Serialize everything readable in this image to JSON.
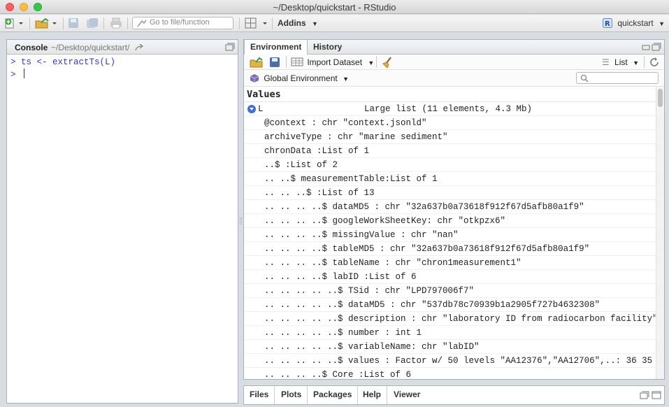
{
  "window": {
    "title": "~/Desktop/quickstart - RStudio"
  },
  "toolbar": {
    "goto_placeholder": "Go to file/function",
    "addins_label": "Addins",
    "project_label": "quickstart"
  },
  "console": {
    "title": "Console",
    "path": "~/Desktop/quickstart/",
    "lines": [
      {
        "prompt": ">",
        "code": "ts <- extractTs(L)"
      },
      {
        "prompt": ">",
        "code": ""
      }
    ]
  },
  "environment": {
    "tabs": [
      "Environment",
      "History"
    ],
    "import_dataset_label": "Import Dataset",
    "view_mode_label": "List",
    "scope_label": "Global Environment",
    "section_title": "Values",
    "object": {
      "name": "L",
      "description": "Large list (11 elements, 4.3 Mb)"
    },
    "rows": [
      "@context : chr \"context.jsonld\"",
      "archiveType : chr \"marine sediment\"",
      "chronData :List of 1",
      "..$ :List of 2",
      ".. ..$ measurementTable:List of 1",
      ".. .. ..$ :List of 13",
      ".. .. .. ..$ dataMD5 : chr \"32a637b0a73618f912f67d5afb80a1f9\"",
      ".. .. .. ..$ googleWorkSheetKey: chr \"otkpzx6\"",
      ".. .. .. ..$ missingValue : chr \"nan\"",
      ".. .. .. ..$ tableMD5 : chr \"32a637b0a73618f912f67d5afb80a1f9\"",
      ".. .. .. ..$ tableName : chr \"chron1measurement1\"",
      ".. .. .. ..$ labID :List of 6",
      ".. .. .. .. ..$ TSid : chr \"LPD797006f7\"",
      ".. .. .. .. ..$ dataMD5 : chr \"537db78c70939b1a2905f727b4632308\"",
      ".. .. .. .. ..$ description : chr \"laboratory ID from radiocarbon facility\"",
      ".. .. .. .. ..$ number : int 1",
      ".. .. .. .. ..$ variableName: chr \"labID\"",
      ".. .. .. .. ..$ values : Factor w/ 50 levels \"AA12376\",\"AA12706\",..: 36 35 …",
      ".. .. .. ..$ Core :List of 6"
    ]
  },
  "bottom_tabs": [
    "Files",
    "Plots",
    "Packages",
    "Help",
    "Viewer"
  ],
  "colors": {
    "console_code": "#2e3ac6",
    "accent": "#3d6fd6"
  }
}
